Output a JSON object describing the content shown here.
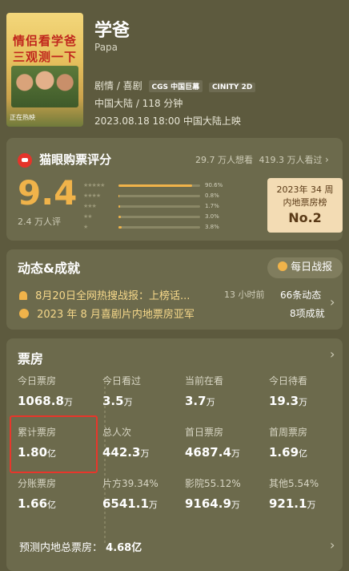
{
  "movie": {
    "title": "学爸",
    "subtitle": "Papa",
    "genre": "剧情 / 喜剧",
    "tags": [
      "CGS 中国巨幕",
      "CINITY 2D"
    ],
    "region_runtime": "中国大陆 / 118 分钟",
    "release": "2023.08.18 18:00 中国大陆上映",
    "poster": {
      "line1": "情侣看学爸",
      "line2": "三观测一下",
      "bottom_text": "正在热映"
    }
  },
  "rating": {
    "section_title": "猫眼购票评分",
    "want_to_see": "29.7 万人想看",
    "watched": "419.3 万人看过",
    "score": "9.4",
    "rating_count": "2.4 万人评",
    "distribution": [
      {
        "stars": "★★★★★",
        "pct_label": "90.6%",
        "pct": 90.6
      },
      {
        "stars": "★★★★",
        "pct_label": "0.8%",
        "pct": 0.8
      },
      {
        "stars": "★★★",
        "pct_label": "1.7%",
        "pct": 1.7
      },
      {
        "stars": "★★",
        "pct_label": "3.0%",
        "pct": 3.0
      },
      {
        "stars": "★",
        "pct_label": "3.8%",
        "pct": 3.8
      }
    ],
    "rank_badge": {
      "line1": "2023年 34 周",
      "line2": "内地票房榜",
      "rank": "No.2"
    }
  },
  "dynamics": {
    "section_title": "动态&成就",
    "daily_report": "每日战报",
    "news": {
      "text": "8月20日全网热搜战报：上榜话...",
      "time": "13 小时前",
      "count": "66条动态"
    },
    "achievement": {
      "text": "2023 年 8 月喜剧片内地票房亚军",
      "count": "8项成就"
    }
  },
  "box_office": {
    "section_title": "票房",
    "rows": [
      [
        {
          "label": "今日票房",
          "value": "1068.8",
          "unit": "万"
        },
        {
          "label": "今日看过",
          "value": "3.5",
          "unit": "万"
        },
        {
          "label": "当前在看",
          "value": "3.7",
          "unit": "万"
        },
        {
          "label": "今日待看",
          "value": "19.3",
          "unit": "万"
        }
      ],
      [
        {
          "label": "累计票房",
          "value": "1.80",
          "unit": "亿"
        },
        {
          "label": "总人次",
          "value": "442.3",
          "unit": "万"
        },
        {
          "label": "首日票房",
          "value": "4687.4",
          "unit": "万"
        },
        {
          "label": "首周票房",
          "value": "1.69",
          "unit": "亿"
        }
      ],
      [
        {
          "label": "分账票房",
          "value": "1.66",
          "unit": "亿"
        },
        {
          "label": "片方39.34%",
          "value": "6541.1",
          "unit": "万"
        },
        {
          "label": "影院55.12%",
          "value": "9164.9",
          "unit": "万"
        },
        {
          "label": "其他5.54%",
          "value": "921.1",
          "unit": "万"
        }
      ]
    ],
    "forecast_label": "预测内地总票房：",
    "forecast_value": "4.68亿"
  },
  "colors": {
    "background": "#5d5a3e",
    "card": "#6c6a4c",
    "accent": "#f0b34a",
    "highlight_border": "#e8362b"
  }
}
